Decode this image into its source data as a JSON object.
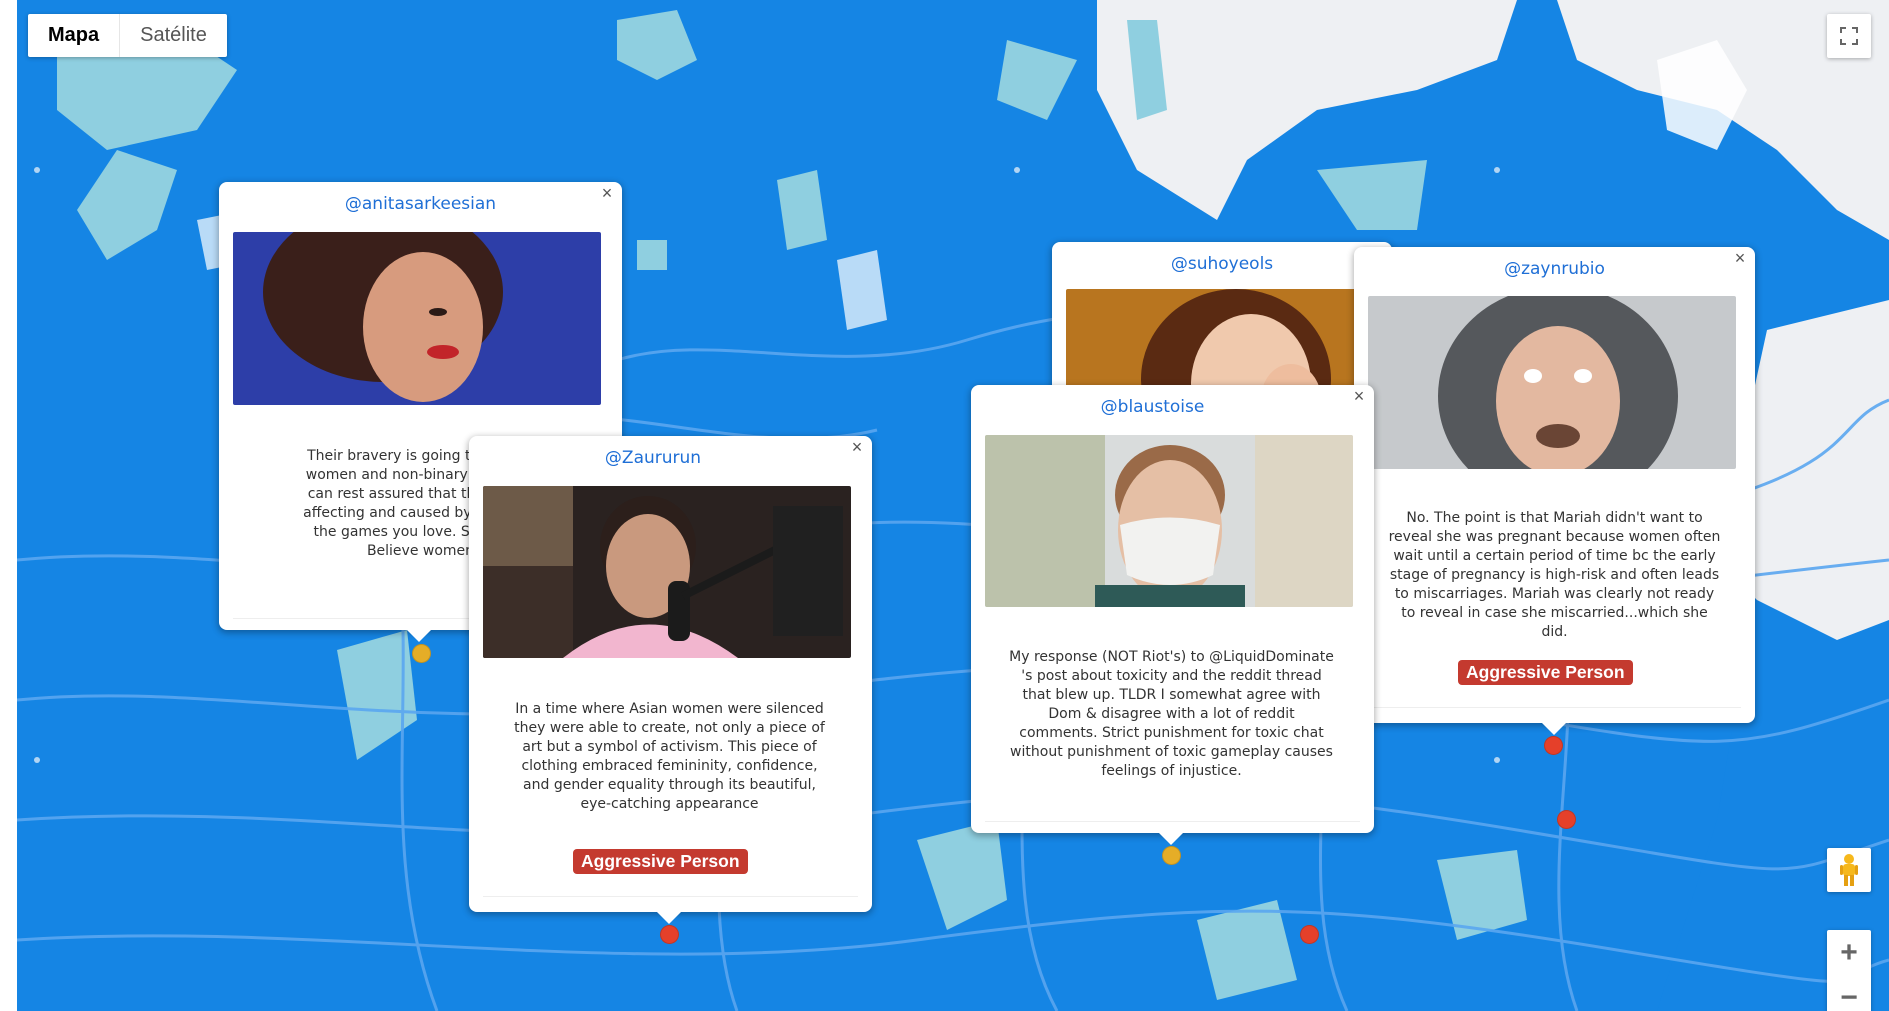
{
  "map_type": {
    "options": [
      "Mapa",
      "Satélite"
    ],
    "selected": "Mapa"
  },
  "controls": {
    "zoom_in": "+",
    "zoom_out": "−"
  },
  "colors": {
    "water": "#1585e4",
    "land_light": "#8fcfe0",
    "roads": "#5aa6f0",
    "marker_yellow": "#e5ad27",
    "marker_red": "#e5402a",
    "badge": "#c43a2f",
    "username": "#1f6fd6"
  },
  "markers": [
    {
      "color": "yellow"
    },
    {
      "color": "red"
    },
    {
      "color": "yellow"
    },
    {
      "color": "red"
    },
    {
      "color": "red"
    },
    {
      "color": "red"
    }
  ],
  "cards": [
    {
      "username": "@anitasarkeesian",
      "text_lines": [
        "Their bravery is going to give co",
        "women and non-binary folks to s",
        "can rest assured that this is a m",
        "affecting and caused by the deve",
        "the games you love. So let me",
        "Believe women"
      ],
      "badge": ""
    },
    {
      "username": "@Zaururun",
      "text": "In a time where Asian women were silenced they were able to create, not only a piece of art but a symbol of activism. This piece of clothing embraced femininity, confidence, and gender equality through its beautiful, eye-catching appearance",
      "badge": "Aggressive Person"
    },
    {
      "username": "@suhoyeols",
      "text": "",
      "badge": ""
    },
    {
      "username": "@blaustoise",
      "text": "My response (NOT Riot's) to @LiquidDominate 's post about toxicity and the reddit thread that blew up. TLDR I somewhat agree with Dom & disagree with a lot of reddit comments. Strict punishment for toxic chat without punishment of toxic gameplay causes feelings of injustice.",
      "badge": ""
    },
    {
      "username": "@zaynrubio",
      "text": "No. The point is that Mariah didn't want to reveal she was pregnant because women often wait until a certain period of time bc the early stage of pregnancy is high-risk and often leads to miscarriages. Mariah was clearly not ready to reveal in case she miscarried...which she did.",
      "badge": "Aggressive Person"
    }
  ]
}
